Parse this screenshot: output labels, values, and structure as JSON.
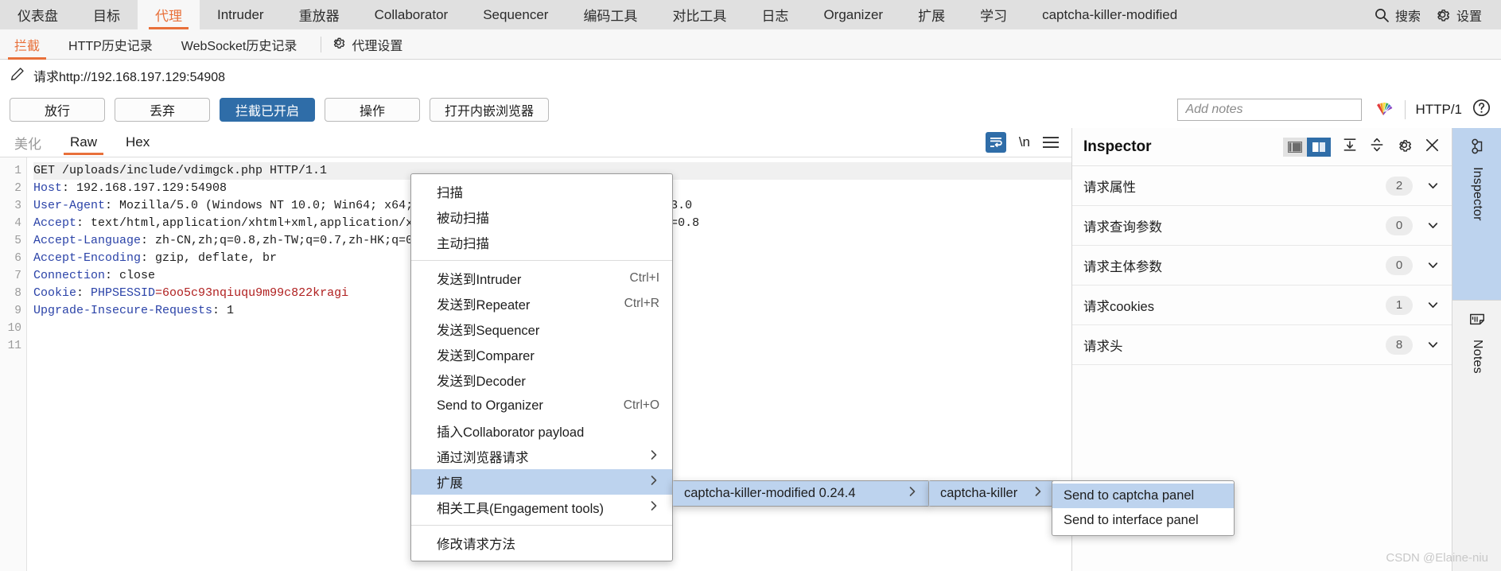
{
  "topbar": {
    "tabs": [
      {
        "label": "仪表盘",
        "active": false
      },
      {
        "label": "目标",
        "active": false
      },
      {
        "label": "代理",
        "active": true
      },
      {
        "label": "Intruder",
        "active": false
      },
      {
        "label": "重放器",
        "active": false
      },
      {
        "label": "Collaborator",
        "active": false
      },
      {
        "label": "Sequencer",
        "active": false
      },
      {
        "label": "编码工具",
        "active": false
      },
      {
        "label": "对比工具",
        "active": false
      },
      {
        "label": "日志",
        "active": false
      },
      {
        "label": "Organizer",
        "active": false
      },
      {
        "label": "扩展",
        "active": false
      },
      {
        "label": "学习",
        "active": false
      },
      {
        "label": "captcha-killer-modified",
        "active": false
      }
    ],
    "search_label": "搜索",
    "settings_label": "设置",
    "search_icon": "search-icon",
    "settings_icon": "gear-icon"
  },
  "subbar": {
    "tabs": [
      {
        "label": "拦截",
        "active": true
      },
      {
        "label": "HTTP历史记录",
        "active": false
      },
      {
        "label": "WebSocket历史记录",
        "active": false
      }
    ],
    "settings_label": "代理设置",
    "settings_icon": "gear-icon"
  },
  "request_header": {
    "edit_icon": "pencil-icon",
    "title": "请求http://192.168.197.129:54908"
  },
  "actionbar": {
    "buttons": [
      {
        "label": "放行",
        "primary": false
      },
      {
        "label": "丢弃",
        "primary": false
      },
      {
        "label": "拦截已开启",
        "primary": true
      },
      {
        "label": "操作",
        "primary": false
      },
      {
        "label": "打开内嵌浏览器",
        "primary": false
      }
    ],
    "notes_placeholder": "Add notes",
    "notes_value": "",
    "highlighter_icon": "rainbow-highlighter-icon",
    "http_version": "HTTP/1",
    "help_icon": "help-circle-icon",
    "primary_color": "#2f6da8"
  },
  "editor": {
    "tabs": [
      {
        "label": "美化",
        "active": false,
        "muted": true
      },
      {
        "label": "Raw",
        "active": true,
        "muted": false
      },
      {
        "label": "Hex",
        "active": false,
        "muted": false
      }
    ],
    "tools": {
      "wrap_icon": "word-wrap-icon",
      "newline_label": "\\n",
      "menu_icon": "hamburger-menu-icon"
    },
    "line_numbers": [
      "1",
      "2",
      "3",
      "4",
      "5",
      "6",
      "7",
      "8",
      "9",
      "10",
      "11"
    ],
    "lines": [
      {
        "num": 1,
        "parts": [
          {
            "t": "GET /uploads/include/vdimgck.php HTTP/1.1",
            "c": "plain"
          }
        ]
      },
      {
        "num": 2,
        "parts": [
          {
            "t": "Host",
            "c": "key"
          },
          {
            "t": ": 192.168.197.129:54908",
            "c": "plain"
          }
        ]
      },
      {
        "num": 3,
        "parts": [
          {
            "t": "User-Agent",
            "c": "key"
          },
          {
            "t": ": Mozilla/5.0 (Windows NT 10.0; Win64; x64; rv:123.0) Gecko/20100101 Firefox/123.0",
            "c": "plain"
          }
        ]
      },
      {
        "num": 4,
        "parts": [
          {
            "t": "Accept",
            "c": "key"
          },
          {
            "t": ": text/html,application/xhtml+xml,application/xml;q=0.9,image/avif,image/webp,*/*;q=0.8",
            "c": "plain"
          }
        ]
      },
      {
        "num": 5,
        "parts": [
          {
            "t": "Accept-Language",
            "c": "key"
          },
          {
            "t": ": zh-CN,zh;q=0.8,zh-TW;q=0.7,zh-HK;q=0.5,en-US;q=0.3,en;q=0.2",
            "c": "plain"
          }
        ]
      },
      {
        "num": 6,
        "parts": [
          {
            "t": "Accept-Encoding",
            "c": "key"
          },
          {
            "t": ": gzip, deflate, br",
            "c": "plain"
          }
        ]
      },
      {
        "num": 7,
        "parts": [
          {
            "t": "Connection",
            "c": "key"
          },
          {
            "t": ": close",
            "c": "plain"
          }
        ]
      },
      {
        "num": 8,
        "parts": [
          {
            "t": "Cookie",
            "c": "key"
          },
          {
            "t": ": ",
            "c": "plain"
          },
          {
            "t": "PHPSESSID",
            "c": "key"
          },
          {
            "t": "=6oo5c93nqiuqu9m99c822kragi",
            "c": "red"
          }
        ]
      },
      {
        "num": 9,
        "parts": [
          {
            "t": "Upgrade-Insecure-Requests",
            "c": "key"
          },
          {
            "t": ": 1",
            "c": "plain"
          }
        ]
      },
      {
        "num": 10,
        "parts": [
          {
            "t": "",
            "c": "plain"
          }
        ]
      },
      {
        "num": 11,
        "parts": [
          {
            "t": "",
            "c": "plain"
          }
        ]
      }
    ]
  },
  "context_menu": {
    "items": [
      {
        "label": "扫描",
        "shortcut": "",
        "arrow": false,
        "highlighted": false,
        "divider_after": false
      },
      {
        "label": "被动扫描",
        "shortcut": "",
        "arrow": false,
        "highlighted": false,
        "divider_after": false
      },
      {
        "label": "主动扫描",
        "shortcut": "",
        "arrow": false,
        "highlighted": false,
        "divider_after": true
      },
      {
        "label": "发送到Intruder",
        "shortcut": "Ctrl+I",
        "arrow": false,
        "highlighted": false,
        "divider_after": false
      },
      {
        "label": "发送到Repeater",
        "shortcut": "Ctrl+R",
        "arrow": false,
        "highlighted": false,
        "divider_after": false
      },
      {
        "label": "发送到Sequencer",
        "shortcut": "",
        "arrow": false,
        "highlighted": false,
        "divider_after": false
      },
      {
        "label": "发送到Comparer",
        "shortcut": "",
        "arrow": false,
        "highlighted": false,
        "divider_after": false
      },
      {
        "label": "发送到Decoder",
        "shortcut": "",
        "arrow": false,
        "highlighted": false,
        "divider_after": false
      },
      {
        "label": "Send to Organizer",
        "shortcut": "Ctrl+O",
        "arrow": false,
        "highlighted": false,
        "divider_after": false
      },
      {
        "label": "插入Collaborator payload",
        "shortcut": "",
        "arrow": false,
        "highlighted": false,
        "divider_after": false
      },
      {
        "label": "通过浏览器请求",
        "shortcut": "",
        "arrow": true,
        "highlighted": false,
        "divider_after": false
      },
      {
        "label": "扩展",
        "shortcut": "",
        "arrow": true,
        "highlighted": true,
        "divider_after": false
      },
      {
        "label": "相关工具(Engagement tools)",
        "shortcut": "",
        "arrow": true,
        "highlighted": false,
        "divider_after": true
      },
      {
        "label": "修改请求方法",
        "shortcut": "",
        "arrow": false,
        "highlighted": false,
        "divider_after": false
      }
    ]
  },
  "submenu_extensions": {
    "items": [
      {
        "label": "captcha-killer-modified 0.24.4",
        "arrow": true,
        "highlighted": true
      }
    ]
  },
  "submenu_plugin": {
    "items": [
      {
        "label": "captcha-killer",
        "arrow": true,
        "highlighted": true
      }
    ]
  },
  "submenu_actions": {
    "items": [
      {
        "label": "Send to captcha panel",
        "arrow": false,
        "highlighted": true
      },
      {
        "label": "Send to interface panel",
        "arrow": false,
        "highlighted": false
      }
    ]
  },
  "inspector": {
    "title": "Inspector",
    "icons": {
      "layout_left": "panel-layout-left-icon",
      "layout_right": "panel-layout-right-icon",
      "expand_all": "expand-all-icon",
      "collapse_all": "collapse-all-icon",
      "settings": "gear-icon",
      "close": "close-icon"
    },
    "rows": [
      {
        "label": "请求属性",
        "count": "2"
      },
      {
        "label": "请求查询参数",
        "count": "0"
      },
      {
        "label": "请求主体参数",
        "count": "0"
      },
      {
        "label": "请求cookies",
        "count": "1"
      },
      {
        "label": "请求头",
        "count": "8"
      }
    ]
  },
  "rail": {
    "tabs": [
      {
        "label": "Inspector",
        "icon": "inspector-glasses-icon",
        "active": true
      },
      {
        "label": "Notes",
        "icon": "notes-document-icon",
        "active": false
      }
    ]
  },
  "watermark": "CSDN @Elaine-niu"
}
